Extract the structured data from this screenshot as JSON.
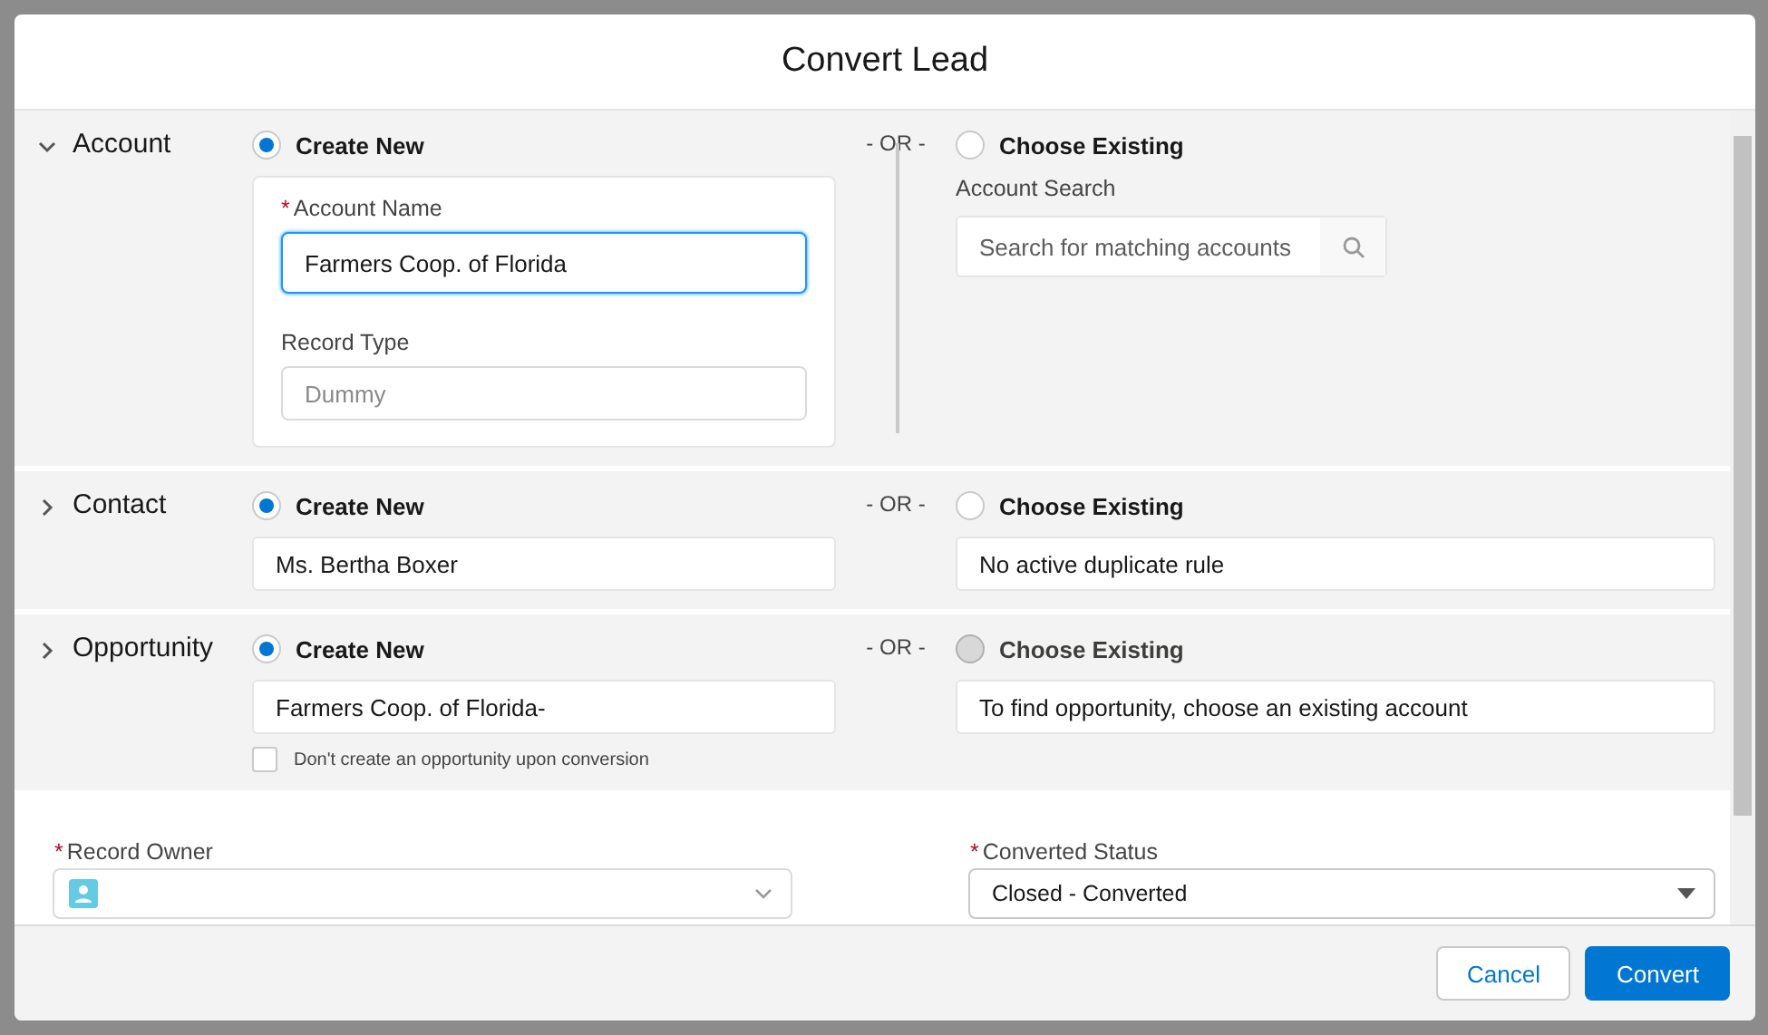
{
  "modal": {
    "title": "Convert Lead"
  },
  "sections": [
    {
      "kind": "account",
      "title": "Account",
      "expanded": true,
      "create_new": {
        "label": "Create New",
        "selected": true
      },
      "separator": "- OR -",
      "choose_existing": {
        "label": "Choose Existing",
        "selected": false,
        "disabled": false
      },
      "new_fields": [
        {
          "label": "Account Name",
          "required_mark": "*",
          "value": "Farmers Coop. of Florida",
          "focused": true
        },
        {
          "label": "Record Type",
          "placeholder": "Dummy",
          "focused": false
        }
      ],
      "search": {
        "label": "Account Search",
        "placeholder": "Search for matching accounts"
      }
    },
    {
      "kind": "simple",
      "title": "Contact",
      "expanded": false,
      "create_new": {
        "label": "Create New",
        "selected": true
      },
      "separator": "- OR -",
      "choose_existing": {
        "label": "Choose Existing",
        "selected": false,
        "disabled": false
      },
      "new_value": "Ms. Bertha Boxer",
      "existing_value": "No active duplicate rule"
    },
    {
      "kind": "simple",
      "title": "Opportunity",
      "expanded": false,
      "create_new": {
        "label": "Create New",
        "selected": true
      },
      "separator": "- OR -",
      "choose_existing": {
        "label": "Choose Existing",
        "selected": false,
        "disabled": true
      },
      "new_value": "Farmers Coop. of Florida-",
      "existing_value": "To find opportunity, choose an existing account",
      "checkbox": {
        "label": "Don't create an opportunity upon conversion",
        "checked": false
      }
    }
  ],
  "owner_fields": [
    {
      "kind": "lookup",
      "label": "Record Owner",
      "required_mark": "*"
    },
    {
      "kind": "select",
      "label": "Converted Status",
      "required_mark": "*",
      "value": "Closed - Converted"
    }
  ],
  "buttons": [
    {
      "kind": "neutral",
      "label": "Cancel"
    },
    {
      "kind": "brand",
      "label": "Convert"
    }
  ]
}
